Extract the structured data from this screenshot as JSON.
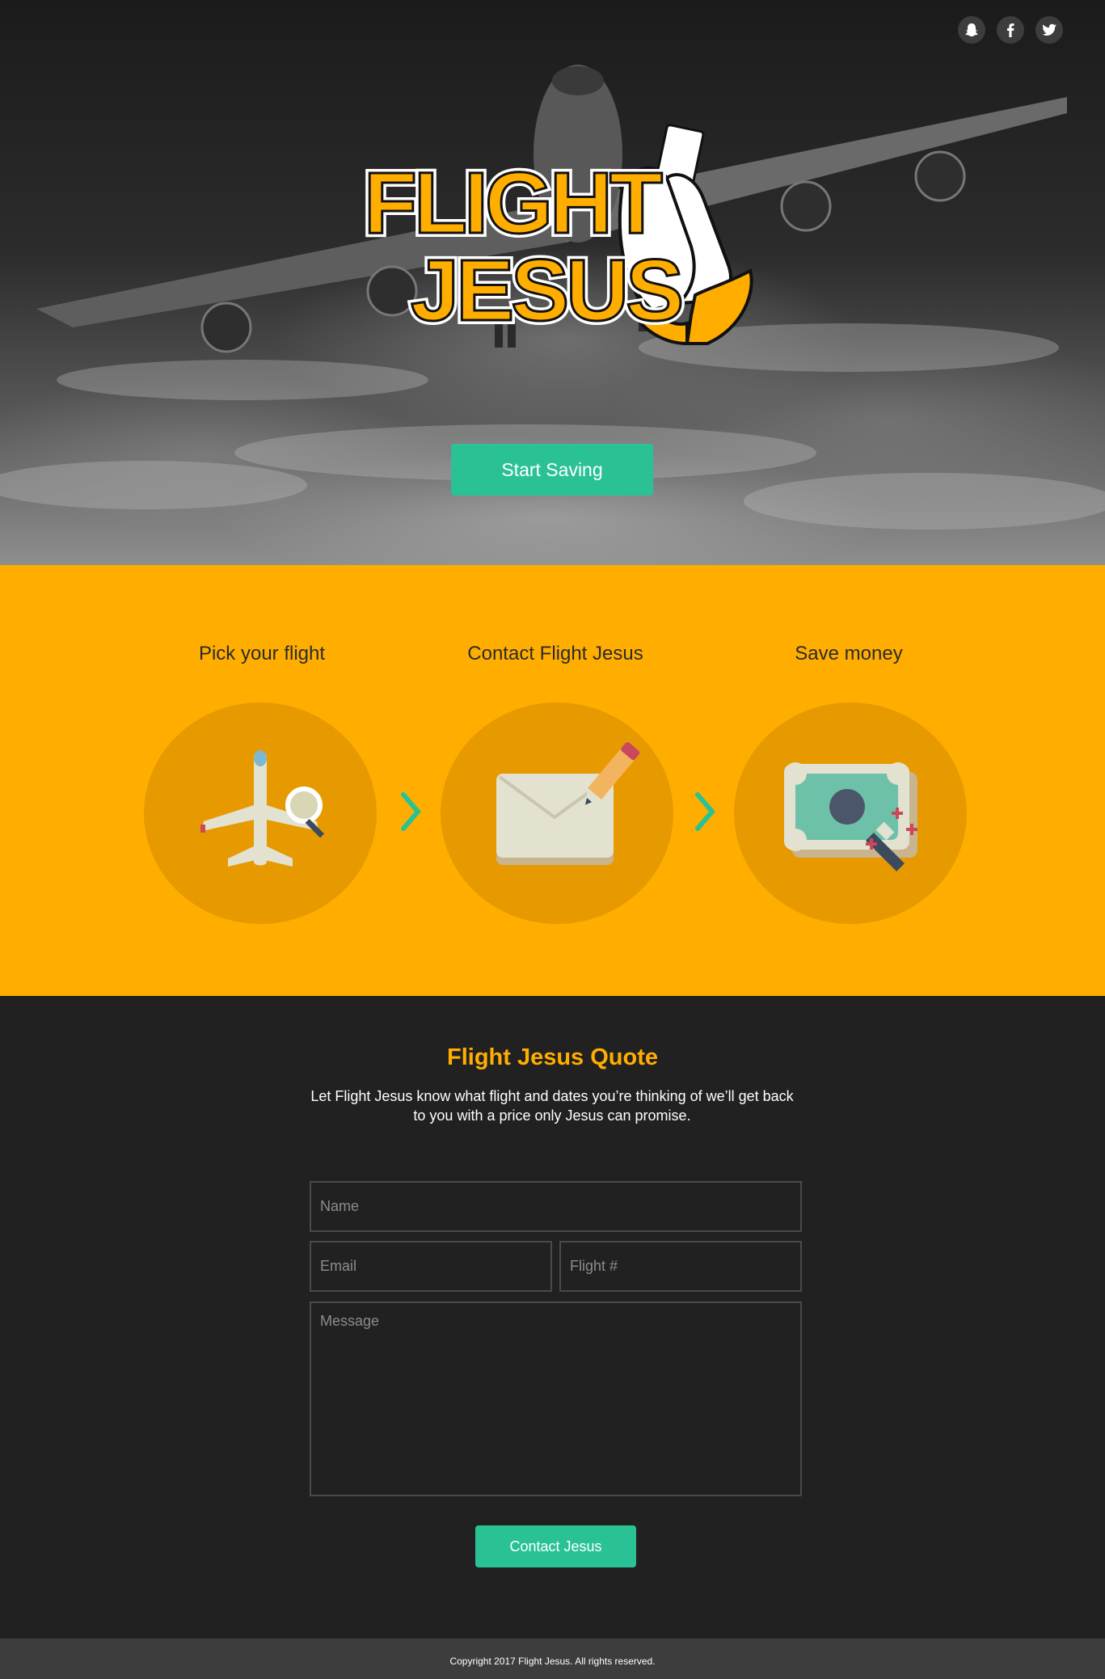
{
  "hero": {
    "social": [
      {
        "name": "snapchat-icon"
      },
      {
        "name": "facebook-icon"
      },
      {
        "name": "twitter-icon"
      }
    ],
    "logo_line1": "FLIGHT",
    "logo_line2": "JESUS",
    "cta_label": "Start Saving"
  },
  "steps": {
    "items": [
      {
        "title": "Pick your flight",
        "icon": "plane-search-icon"
      },
      {
        "title": "Contact Flight Jesus",
        "icon": "envelope-pencil-icon"
      },
      {
        "title": "Save money",
        "icon": "money-wand-icon"
      }
    ],
    "separator_icon": "chevron-right-icon"
  },
  "quote": {
    "heading": "Flight Jesus Quote",
    "description": "Let Flight Jesus know what flight and dates you’re thinking of we’ll get back to you with a price only Jesus can promise.",
    "name_placeholder": "Name",
    "email_placeholder": "Email",
    "flight_placeholder": "Flight #",
    "message_placeholder": "Message",
    "submit_label": "Contact Jesus"
  },
  "footer": {
    "copyright": "Copyright 2017 Flight Jesus. All rights reserved."
  },
  "colors": {
    "accent_green": "#2ac295",
    "brand_yellow": "#ffae00",
    "circle_yellow": "#e69a00",
    "dark_bg": "#212121",
    "footer_bg": "#3d3d3d"
  }
}
